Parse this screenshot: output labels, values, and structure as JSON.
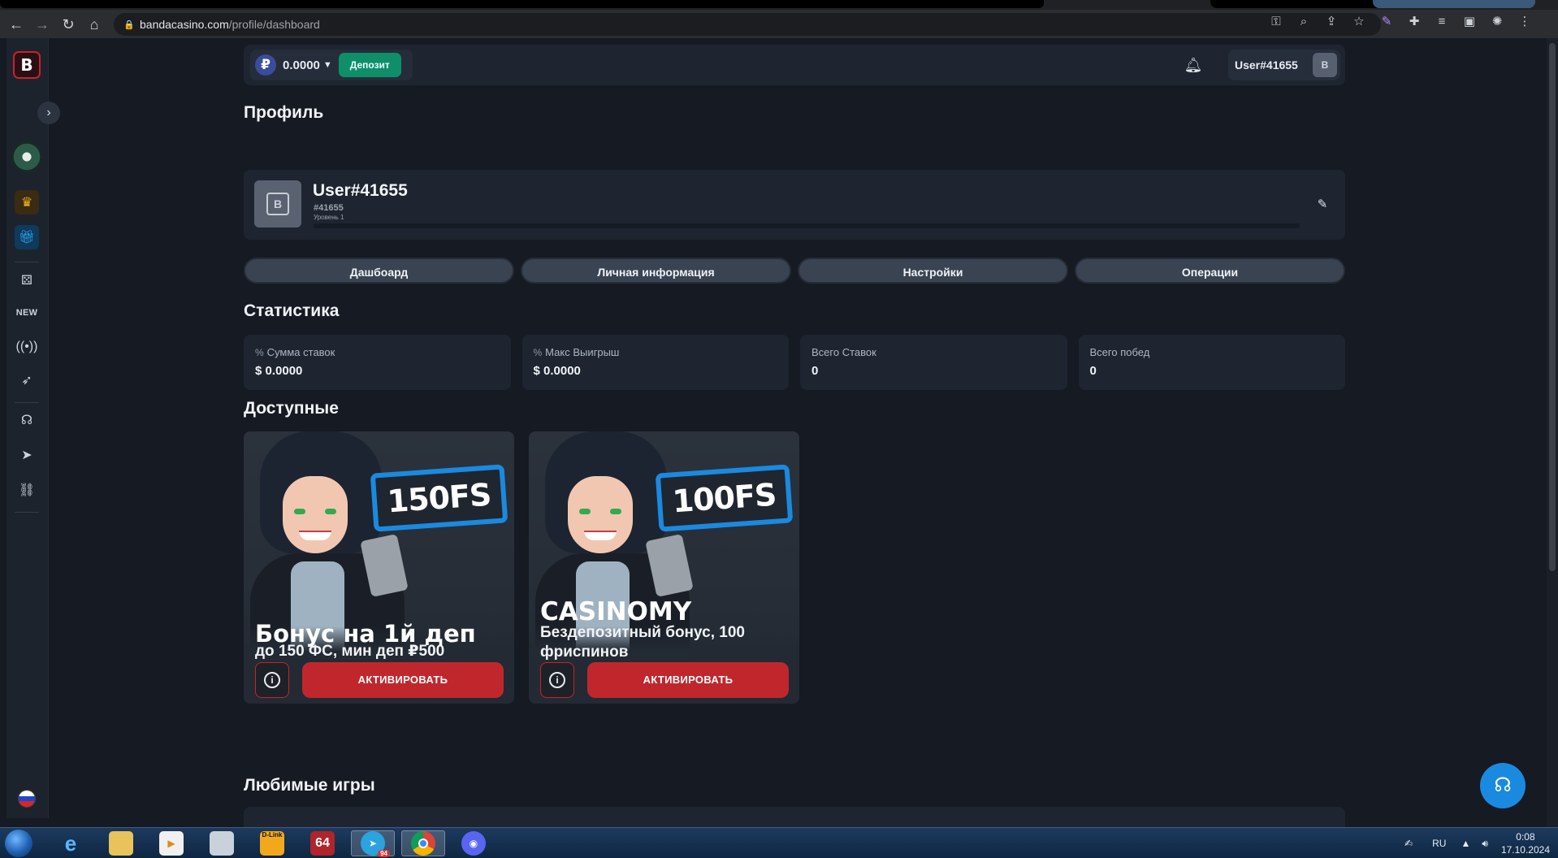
{
  "browser": {
    "url_domain": "bandacasino.com",
    "url_path": "/profile/dashboard"
  },
  "sidebar": {
    "logo_letter": "B",
    "new_label": "NEW"
  },
  "header": {
    "currency_symbol": "₽",
    "balance": "0.0000",
    "deposit_label": "Депозит",
    "username": "User#41655"
  },
  "profile": {
    "section_title": "Профиль",
    "name": "User#41655",
    "id": "#41655",
    "level": "Уровень 1",
    "level_progress": 0.0
  },
  "tabs": [
    {
      "label": "Дашбоард"
    },
    {
      "label": "Личная информация"
    },
    {
      "label": "Настройки"
    },
    {
      "label": "Операции"
    }
  ],
  "stats": {
    "section_title": "Статистика",
    "items": [
      {
        "label": "Сумма ставок",
        "value": "$ 0.0000",
        "icon": "percent-icon"
      },
      {
        "label": "Макс Выигрыш",
        "value": "$ 0.0000",
        "icon": "percent-icon"
      },
      {
        "label": "Всего Ставок",
        "value": "0"
      },
      {
        "label": "Всего побед",
        "value": "0"
      }
    ]
  },
  "available": {
    "section_title": "Доступные",
    "bonuses": [
      {
        "badge": "150FS",
        "title": "Бонус на 1й деп",
        "subtitle": "до 150 ФС, мин деп ₽500",
        "activate_label": "АКТИВИРОВАТЬ"
      },
      {
        "badge": "100FS",
        "title": "CASINOMY",
        "subtitle": "Бездепозитный бонус, 100 фриспинов",
        "activate_label": "АКТИВИРОВАТЬ"
      }
    ]
  },
  "favorites": {
    "section_title": "Любимые игры"
  },
  "taskbar": {
    "lang": "RU",
    "time": "0:08",
    "date": "17.10.2024",
    "telegram_badge": "94",
    "dlink_label": "D-Link"
  },
  "colors": {
    "accent_red": "#c0272d",
    "deposit_green": "#0e8f6a",
    "badge_blue": "#1a8ae0",
    "card_bg": "#1e2530",
    "page_bg": "#151a23"
  }
}
